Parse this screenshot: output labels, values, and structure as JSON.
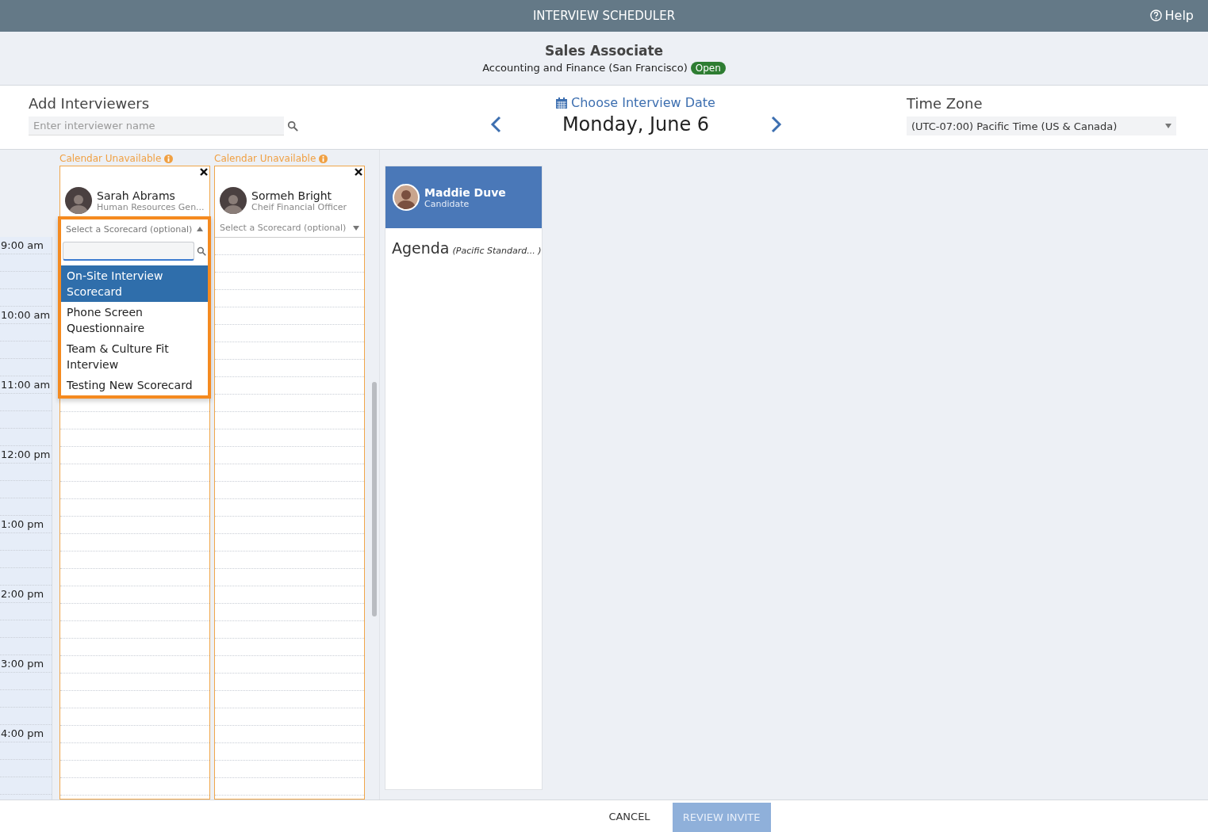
{
  "header": {
    "title": "INTERVIEW SCHEDULER",
    "help": "Help"
  },
  "job": {
    "title": "Sales Associate",
    "department": "Accounting and Finance (San Francisco)",
    "status": "Open"
  },
  "interviewer_search": {
    "label": "Add Interviewers",
    "placeholder": "Enter interviewer name"
  },
  "date_picker": {
    "label": "Choose Interview Date",
    "date": "Monday, June 6"
  },
  "time_zone": {
    "label": "Time Zone",
    "value": "(UTC-07:00) Pacific Time (US & Canada)"
  },
  "time_labels": [
    "9:00 am",
    "10:00 am",
    "11:00 am",
    "12:00 pm",
    "1:00 pm",
    "2:00 pm",
    "3:00 pm",
    "4:00 pm"
  ],
  "interviewers": [
    {
      "warning": "Calendar Unavailable",
      "name": "Sarah Abrams",
      "role": "Human Resources Gen...",
      "scorecard_placeholder": "Select a Scorecard (optional)",
      "expanded": true,
      "scorecard_options": [
        {
          "label": "On-Site Interview Scorecard",
          "selected": true
        },
        {
          "label": "Phone Screen Questionnaire",
          "selected": false
        },
        {
          "label": "Team & Culture Fit Interview",
          "selected": false
        },
        {
          "label": "Testing New Scorecard",
          "selected": false
        }
      ]
    },
    {
      "warning": "Calendar Unavailable",
      "name": "Sormeh Bright",
      "role": "Cheif Financial Officer",
      "scorecard_placeholder": "Select a Scorecard (optional)",
      "expanded": false
    }
  ],
  "candidate": {
    "name": "Maddie Duve",
    "role": "Candidate",
    "agenda": "Agenda",
    "agenda_time_zone": "(Pacific Standard... )"
  },
  "footer": {
    "cancel": "CANCEL",
    "review": "REVIEW INVITE",
    "review_disabled": true
  }
}
